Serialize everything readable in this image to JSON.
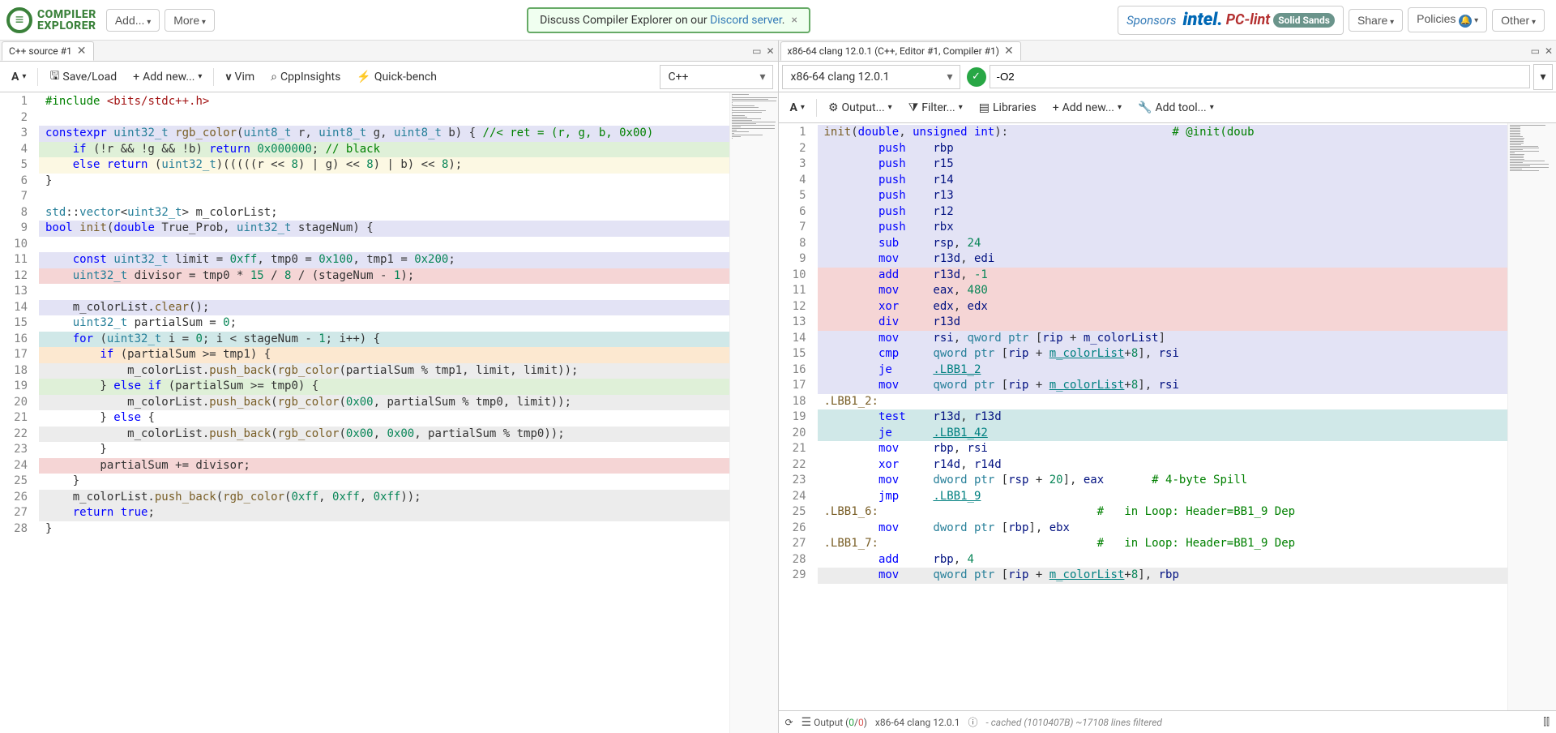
{
  "nav": {
    "logo_line1": "COMPILER",
    "logo_line2": "EXPLORER",
    "add": "Add...",
    "more": "More",
    "discord_prefix": "Discuss Compiler Explorer on our ",
    "discord_link": "Discord server",
    "sponsors_label": "Sponsors",
    "sponsor1": "intel.",
    "sponsor2": "PC-lint",
    "sponsor3": "Solid Sands",
    "share": "Share",
    "policies": "Policies",
    "other": "Other"
  },
  "left": {
    "tab": "C++ source #1",
    "toolbar": {
      "saveload": "Save/Load",
      "addnew": "Add new...",
      "vim": "Vim",
      "cppinsights": "CppInsights",
      "quickbench": "Quick-bench",
      "lang": "C++"
    },
    "gutter": [
      "1",
      "2",
      "3",
      "4",
      "5",
      "6",
      "7",
      "8",
      "9",
      "10",
      "11",
      "12",
      "13",
      "14",
      "15",
      "16",
      "17",
      "18",
      "19",
      "20",
      "21",
      "22",
      "23",
      "24",
      "25",
      "26",
      "27",
      "28"
    ],
    "code": [
      {
        "bg": "",
        "html": "<span class='c-pre'>#include</span> <span class='c-str'>&lt;bits/stdc++.h&gt;</span>"
      },
      {
        "bg": "",
        "html": ""
      },
      {
        "bg": "bg-lav",
        "html": "<span class='c-kw'>constexpr</span> <span class='c-type'>uint32_t</span> <span class='c-fn'>rgb_color</span>(<span class='c-type'>uint8_t</span> r, <span class='c-type'>uint8_t</span> g, <span class='c-type'>uint8_t</span> b) { <span class='c-cm'>//&lt; ret = (r, g, b, 0x00)</span>"
      },
      {
        "bg": "bg-grn",
        "html": "    <span class='c-kw'>if</span> (!r &amp;&amp; !g &amp;&amp; !b) <span class='c-kw'>return</span> <span class='c-num'>0x000000</span>; <span class='c-cm'>// black</span>"
      },
      {
        "bg": "bg-yel",
        "html": "    <span class='c-kw'>else</span> <span class='c-kw'>return</span> (<span class='c-type'>uint32_t</span>)(((((r &lt;&lt; <span class='c-num'>8</span>) | g) &lt;&lt; <span class='c-num'>8</span>) | b) &lt;&lt; <span class='c-num'>8</span>);"
      },
      {
        "bg": "",
        "html": "}"
      },
      {
        "bg": "",
        "html": ""
      },
      {
        "bg": "",
        "html": "<span class='c-type'>std</span>::<span class='c-type'>vector</span>&lt;<span class='c-type'>uint32_t</span>&gt; m_colorList;"
      },
      {
        "bg": "bg-lav",
        "html": "<span class='c-kw'>bool</span> <span class='c-fn'>init</span>(<span class='c-kw'>double</span> True_Prob, <span class='c-type'>uint32_t</span> stageNum) {"
      },
      {
        "bg": "",
        "html": ""
      },
      {
        "bg": "bg-lav",
        "html": "    <span class='c-kw'>const</span> <span class='c-type'>uint32_t</span> limit = <span class='c-num'>0xff</span>, tmp0 = <span class='c-num'>0x100</span>, tmp1 = <span class='c-num'>0x200</span>;"
      },
      {
        "bg": "bg-pnk",
        "html": "    <span class='c-type'>uint32_t</span> divisor = tmp0 * <span class='c-num'>15</span> / <span class='c-num'>8</span> / (stageNum - <span class='c-num'>1</span>);"
      },
      {
        "bg": "",
        "html": ""
      },
      {
        "bg": "bg-lav",
        "html": "    m_colorList.<span class='c-fn'>clear</span>();"
      },
      {
        "bg": "",
        "html": "    <span class='c-type'>uint32_t</span> partialSum = <span class='c-num'>0</span>;"
      },
      {
        "bg": "bg-blu",
        "html": "    <span class='c-kw'>for</span> (<span class='c-type'>uint32_t</span> i = <span class='c-num'>0</span>; i &lt; stageNum - <span class='c-num'>1</span>; i++) {"
      },
      {
        "bg": "bg-org",
        "html": "        <span class='c-kw'>if</span> (partialSum &gt;= tmp1) {"
      },
      {
        "bg": "bg-gry",
        "html": "            m_colorList.<span class='c-fn'>push_back</span>(<span class='c-fn'>rgb_color</span>(partialSum % tmp1, limit, limit));"
      },
      {
        "bg": "bg-grn",
        "html": "        } <span class='c-kw'>else if</span> (partialSum &gt;= tmp0) {"
      },
      {
        "bg": "bg-gry",
        "html": "            m_colorList.<span class='c-fn'>push_back</span>(<span class='c-fn'>rgb_color</span>(<span class='c-num'>0x00</span>, partialSum % tmp0, limit));"
      },
      {
        "bg": "",
        "html": "        } <span class='c-kw'>else</span> {"
      },
      {
        "bg": "bg-gry",
        "html": "            m_colorList.<span class='c-fn'>push_back</span>(<span class='c-fn'>rgb_color</span>(<span class='c-num'>0x00</span>, <span class='c-num'>0x00</span>, partialSum % tmp0));"
      },
      {
        "bg": "",
        "html": "        }"
      },
      {
        "bg": "bg-pnk",
        "html": "        partialSum += divisor;"
      },
      {
        "bg": "",
        "html": "    }"
      },
      {
        "bg": "bg-gry",
        "html": "    m_colorList.<span class='c-fn'>push_back</span>(<span class='c-fn'>rgb_color</span>(<span class='c-num'>0xff</span>, <span class='c-num'>0xff</span>, <span class='c-num'>0xff</span>));"
      },
      {
        "bg": "bg-gry",
        "html": "    <span class='c-kw'>return</span> <span class='c-kw'>true</span>;"
      },
      {
        "bg": "",
        "html": "}"
      }
    ]
  },
  "right": {
    "tab": "x86-64 clang 12.0.1 (C++, Editor #1, Compiler #1)",
    "compiler": "x86-64 clang 12.0.1",
    "opts": "-O2",
    "toolbar": {
      "output": "Output...",
      "filter": "Filter...",
      "libraries": "Libraries",
      "addnew": "Add new...",
      "addtool": "Add tool..."
    },
    "gutter": [
      "1",
      "2",
      "3",
      "4",
      "5",
      "6",
      "7",
      "8",
      "9",
      "10",
      "11",
      "12",
      "13",
      "14",
      "15",
      "16",
      "17",
      "18",
      "19",
      "20",
      "21",
      "22",
      "23",
      "24",
      "25",
      "26",
      "27",
      "28",
      "29"
    ],
    "asm": [
      {
        "bg": "bg-lav",
        "html": "<span class='c-fn'>init</span>(<span class='c-kw'>double</span>, <span class='c-kw'>unsigned int</span>):                        <span class='c-cm'># @init(doub</span>"
      },
      {
        "bg": "bg-lav",
        "html": "        <span class='c-kw'>push</span>    <span class='c-id'>rbp</span>"
      },
      {
        "bg": "bg-lav",
        "html": "        <span class='c-kw'>push</span>    <span class='c-id'>r15</span>"
      },
      {
        "bg": "bg-lav",
        "html": "        <span class='c-kw'>push</span>    <span class='c-id'>r14</span>"
      },
      {
        "bg": "bg-lav",
        "html": "        <span class='c-kw'>push</span>    <span class='c-id'>r13</span>"
      },
      {
        "bg": "bg-lav",
        "html": "        <span class='c-kw'>push</span>    <span class='c-id'>r12</span>"
      },
      {
        "bg": "bg-lav",
        "html": "        <span class='c-kw'>push</span>    <span class='c-id'>rbx</span>"
      },
      {
        "bg": "bg-lav",
        "html": "        <span class='c-kw'>sub</span>     <span class='c-id'>rsp</span>, <span class='c-num'>24</span>"
      },
      {
        "bg": "bg-lav",
        "html": "        <span class='c-kw'>mov</span>     <span class='c-id'>r13d</span>, <span class='c-id'>edi</span>"
      },
      {
        "bg": "bg-pnk",
        "html": "        <span class='c-kw'>add</span>     <span class='c-id'>r13d</span>, <span class='c-num'>-1</span>"
      },
      {
        "bg": "bg-pnk",
        "html": "        <span class='c-kw'>mov</span>     <span class='c-id'>eax</span>, <span class='c-num'>480</span>"
      },
      {
        "bg": "bg-pnk",
        "html": "        <span class='c-kw'>xor</span>     <span class='c-id'>edx</span>, <span class='c-id'>edx</span>"
      },
      {
        "bg": "bg-pnk",
        "html": "        <span class='c-kw'>div</span>     <span class='c-id'>r13d</span>"
      },
      {
        "bg": "bg-lav",
        "html": "        <span class='c-kw'>mov</span>     <span class='c-id'>rsi</span>, <span class='c-type'>qword ptr</span> [<span class='c-id'>rip</span> + <span class='c-id'>m_colorList</span>]"
      },
      {
        "bg": "bg-lav",
        "html": "        <span class='c-kw'>cmp</span>     <span class='c-type'>qword ptr</span> [<span class='c-id'>rip</span> + <span class='c-lbl'>m_colorList</span>+<span class='c-num'>8</span>], <span class='c-id'>rsi</span>"
      },
      {
        "bg": "bg-lav",
        "html": "        <span class='c-kw'>je</span>      <span class='c-lbl'>.LBB1_2</span>"
      },
      {
        "bg": "bg-lav",
        "html": "        <span class='c-kw'>mov</span>     <span class='c-type'>qword ptr</span> [<span class='c-id'>rip</span> + <span class='c-lbl'>m_colorList</span>+<span class='c-num'>8</span>], <span class='c-id'>rsi</span>"
      },
      {
        "bg": "",
        "html": "<span class='c-fn'>.LBB1_2:</span>"
      },
      {
        "bg": "bg-blu",
        "html": "        <span class='c-kw'>test</span>    <span class='c-id'>r13d</span>, <span class='c-id'>r13d</span>"
      },
      {
        "bg": "bg-blu",
        "html": "        <span class='c-kw'>je</span>      <span class='c-lbl'>.LBB1_42</span>"
      },
      {
        "bg": "",
        "html": "        <span class='c-kw'>mov</span>     <span class='c-id'>rbp</span>, <span class='c-id'>rsi</span>"
      },
      {
        "bg": "",
        "html": "        <span class='c-kw'>xor</span>     <span class='c-id'>r14d</span>, <span class='c-id'>r14d</span>"
      },
      {
        "bg": "",
        "html": "        <span class='c-kw'>mov</span>     <span class='c-type'>dword ptr</span> [<span class='c-id'>rsp</span> + <span class='c-num'>20</span>], <span class='c-id'>eax</span>       <span class='c-cm'># 4-byte Spill</span>"
      },
      {
        "bg": "",
        "html": "        <span class='c-kw'>jmp</span>     <span class='c-lbl'>.LBB1_9</span>"
      },
      {
        "bg": "",
        "html": "<span class='c-fn'>.LBB1_6:</span>                                <span class='c-cm'>#   in Loop: Header=BB1_9 Dep</span>"
      },
      {
        "bg": "",
        "html": "        <span class='c-kw'>mov</span>     <span class='c-type'>dword ptr</span> [<span class='c-id'>rbp</span>], <span class='c-id'>ebx</span>"
      },
      {
        "bg": "",
        "html": "<span class='c-fn'>.LBB1_7:</span>                                <span class='c-cm'>#   in Loop: Header=BB1_9 Dep</span>"
      },
      {
        "bg": "",
        "html": "        <span class='c-kw'>add</span>     <span class='c-id'>rbp</span>, <span class='c-num'>4</span>"
      },
      {
        "bg": "bg-gry",
        "html": "        <span class='c-kw'>mov</span>     <span class='c-type'>qword ptr</span> [<span class='c-id'>rip</span> + <span class='c-lbl'>m_colorList</span>+<span class='c-num'>8</span>], <span class='c-id'>rbp</span>"
      }
    ],
    "status": {
      "output_label": "Output (",
      "output_green": "0",
      "output_slash": "/",
      "output_red": "0",
      "output_close": ")",
      "compiler": "x86-64 clang 12.0.1",
      "cached": "- cached (1010407B) ~17108 lines filtered"
    }
  }
}
